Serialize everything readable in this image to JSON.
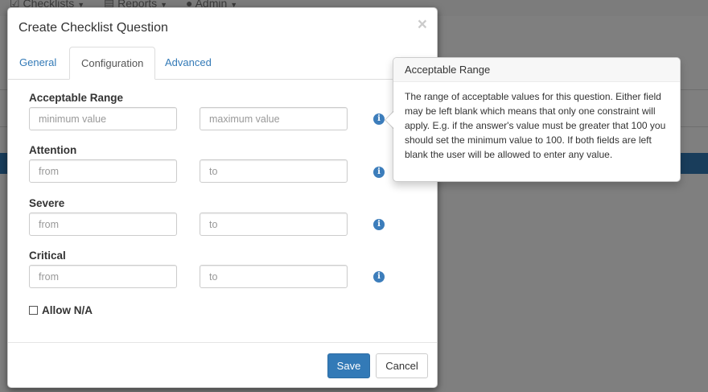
{
  "background": {
    "nav": [
      {
        "icon": "checklist-icon",
        "label": "Checklists"
      },
      {
        "icon": "reports-icon",
        "label": "Reports"
      },
      {
        "icon": "user-icon",
        "label": "Admin"
      }
    ]
  },
  "modal": {
    "title": "Create Checklist Question",
    "close": "×",
    "tabs": [
      {
        "label": "General",
        "active": false
      },
      {
        "label": "Configuration",
        "active": true
      },
      {
        "label": "Advanced",
        "active": false
      }
    ],
    "fields": [
      {
        "label": "Acceptable Range",
        "min_placeholder": "minimum value",
        "max_placeholder": "maximum value"
      },
      {
        "label": "Attention",
        "min_placeholder": "from",
        "max_placeholder": "to"
      },
      {
        "label": "Severe",
        "min_placeholder": "from",
        "max_placeholder": "to"
      },
      {
        "label": "Critical",
        "min_placeholder": "from",
        "max_placeholder": "to"
      }
    ],
    "info_icon": "i",
    "allow_na": {
      "label": "Allow N/A",
      "checked": false
    },
    "buttons": {
      "save": "Save",
      "cancel": "Cancel"
    }
  },
  "popover": {
    "title": "Acceptable Range",
    "content": "The range of acceptable values for this question. Either field may be left blank which means that only one constraint will apply. E.g. if the answer's value must be greater that 100 you should set the minimum value to 100. If both fields are left blank the user will be allowed to enter any value."
  },
  "colors": {
    "primary": "#337ab7",
    "info_icon": "#3c7dbb",
    "backdrop": "rgba(0,0,0,0.5)"
  }
}
